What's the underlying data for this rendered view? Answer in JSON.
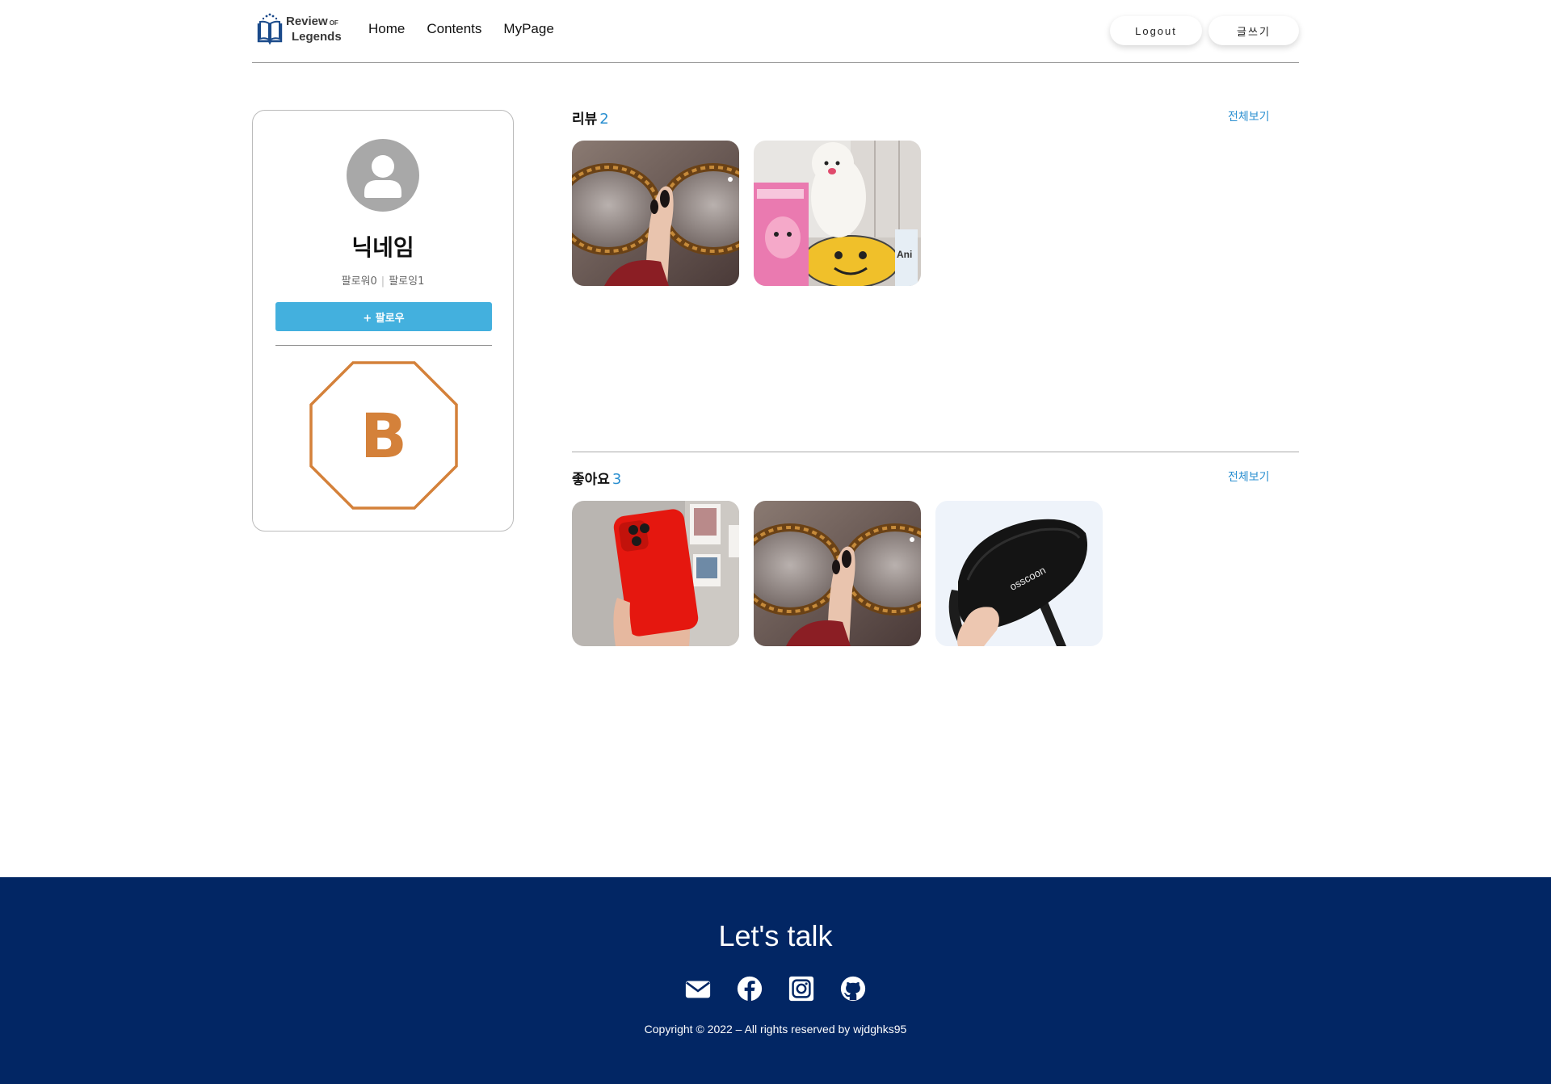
{
  "header": {
    "logo": {
      "line1": "Review",
      "of": "OF",
      "line2": "Legends",
      "icon": "book-icon"
    },
    "nav": [
      {
        "label": "Home"
      },
      {
        "label": "Contents"
      },
      {
        "label": "MyPage"
      }
    ],
    "logout_label": "Logout",
    "write_label": "글쓰기"
  },
  "profile": {
    "avatar_icon": "user-icon",
    "nickname": "닉네임",
    "followers_label": "팔로워0",
    "following_label": "팔로잉1",
    "follow_button_label": "+ 팔로우",
    "grade": "B",
    "grade_color": "#d4813a"
  },
  "reviews": {
    "title": "리뷰",
    "count": "2",
    "see_all_label": "전체보기",
    "items": [
      {
        "subject": "tortoiseshell glasses held in hand"
      },
      {
        "subject": "white pomeranian dog with pink pet food box"
      }
    ]
  },
  "likes": {
    "title": "좋아요",
    "count": "3",
    "see_all_label": "전체보기",
    "items": [
      {
        "subject": "red phone case held in hand"
      },
      {
        "subject": "tortoiseshell glasses held in hand"
      },
      {
        "subject": "black osscoon sling bag held in hand",
        "brand_text": "osscoon"
      }
    ]
  },
  "footer": {
    "title": "Let's talk",
    "icons": [
      "mail-icon",
      "facebook-icon",
      "instagram-icon",
      "github-icon"
    ],
    "copyright": "Copyright © 2022 – All rights reserved by wjdghks95"
  },
  "colors": {
    "accent": "#2a8fd0",
    "follow_button": "#43b0de",
    "footer_bg": "#022664",
    "grade": "#d4813a"
  }
}
